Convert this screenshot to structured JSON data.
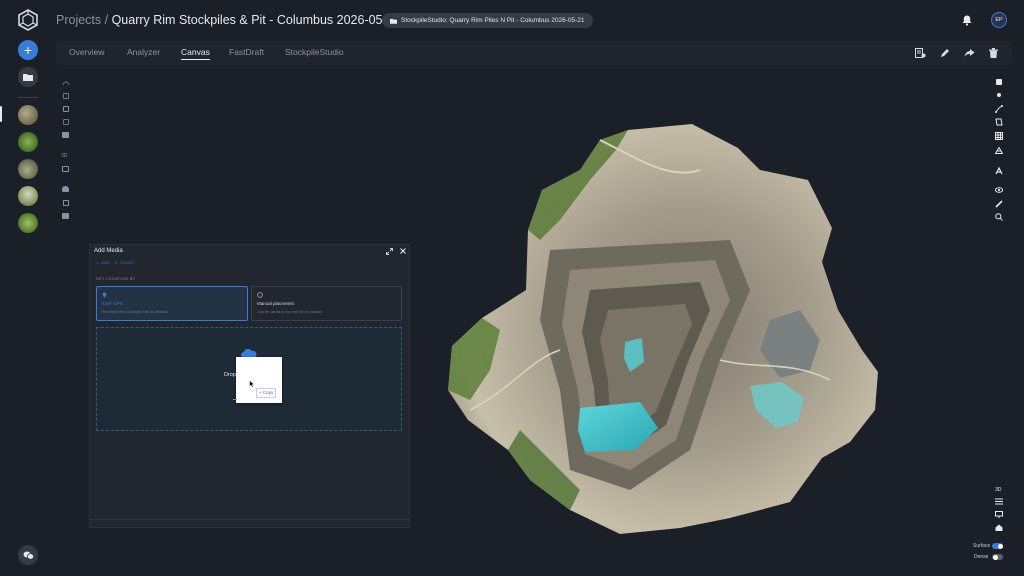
{
  "header": {
    "breadcrumb": "Projects",
    "separator": " / ",
    "title": "Quarry Rim Stockpiles & Pit - Columbus 2026-05-21",
    "chip_label": "StockpileStudio: Quarry Rim Piles N Pit - Columbus 2026-05-21",
    "avatar_initials": "EP"
  },
  "tabs": [
    {
      "label": "Overview"
    },
    {
      "label": "Analyzer"
    },
    {
      "label": "Canvas"
    },
    {
      "label": "FastDraft"
    },
    {
      "label": "StockpileStudio"
    }
  ],
  "active_tab": "Canvas",
  "panel": {
    "title": "Add Media",
    "steps": "1. ADD   2. CHART",
    "section_label": "SET LOCATION BY",
    "option_exif": {
      "title": "EXIF GPS",
      "desc": "Read each file's coordinates from its metadata"
    },
    "option_manual": {
      "title": "Manual placement",
      "desc": "Click the canvas to drop each file at a location"
    },
    "drop_text": "Drop",
    "drag_badge": "+ Copy"
  },
  "right_tools": {
    "label_3d": "3D",
    "surface_label": "Surface",
    "dense_label": "Dense",
    "surface_on": true,
    "dense_on": false
  },
  "left_tools": {
    "label_3d": "3D"
  },
  "colors": {
    "background": "#1b1f27",
    "accent": "#3a7bd5",
    "panel": "#22262e"
  }
}
